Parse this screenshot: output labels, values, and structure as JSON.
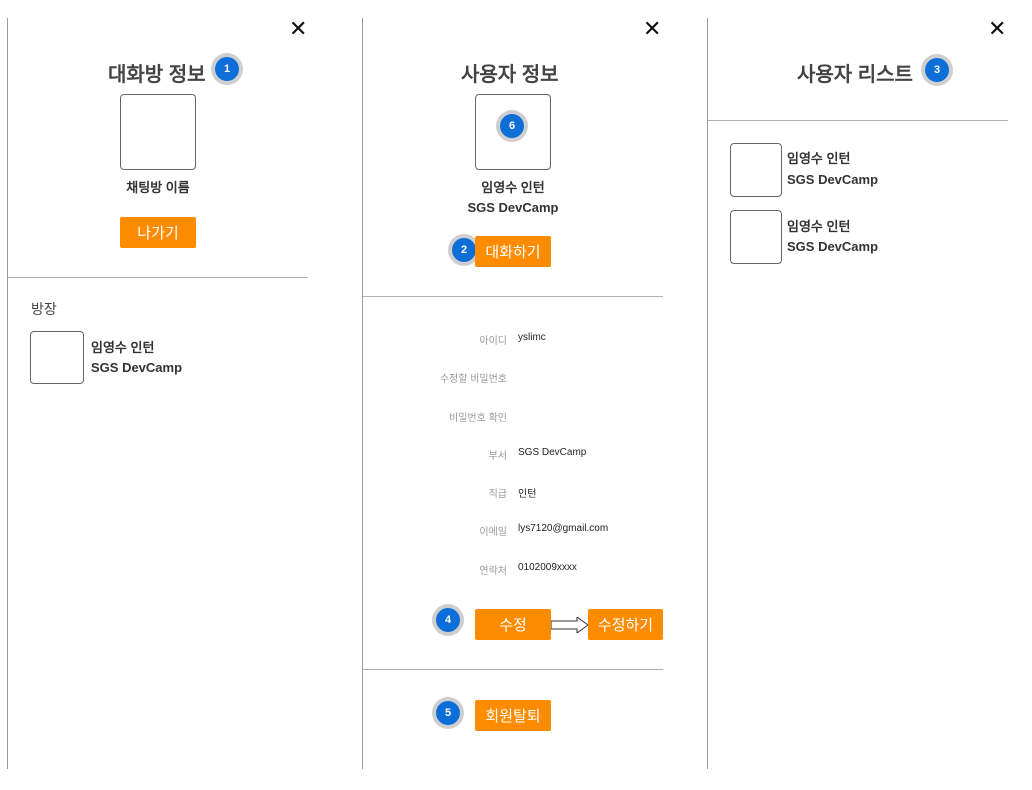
{
  "room_panel": {
    "title": "대화방 정보",
    "badge": "1",
    "chat_name": "채팅방 이름",
    "leave_label": "나가기",
    "owner_heading": "방장",
    "owner": {
      "name": "임영수 인턴",
      "org": "SGS DevCamp"
    }
  },
  "user_panel": {
    "title": "사용자 정보",
    "avatar_badge": "6",
    "name": "임영수 인턴",
    "org": "SGS DevCamp",
    "chat_badge": "2",
    "chat_label": "대화하기",
    "fields": [
      {
        "label": "아이디",
        "value": "yslimc"
      },
      {
        "label": "수정할 비밀번호",
        "value": ""
      },
      {
        "label": "비밀번호 확인",
        "value": ""
      },
      {
        "label": "부서",
        "value": "SGS DevCamp"
      },
      {
        "label": "직급",
        "value": "인턴"
      },
      {
        "label": "이메일",
        "value": "lys7120@gmail.com"
      },
      {
        "label": "연락처",
        "value": "0102009xxxx"
      }
    ],
    "edit_badge": "4",
    "edit_label": "수정",
    "edit_confirm_label": "수정하기",
    "withdraw_badge": "5",
    "withdraw_label": "회원탈퇴"
  },
  "list_panel": {
    "title": "사용자 리스트",
    "badge": "3",
    "users": [
      {
        "name": "임영수 인턴",
        "org": "SGS DevCamp"
      },
      {
        "name": "임영수 인턴",
        "org": "SGS DevCamp"
      }
    ]
  },
  "close_symbol": "✕",
  "accent_color": "#ff8c00",
  "badge_color": "#0d6ed8"
}
